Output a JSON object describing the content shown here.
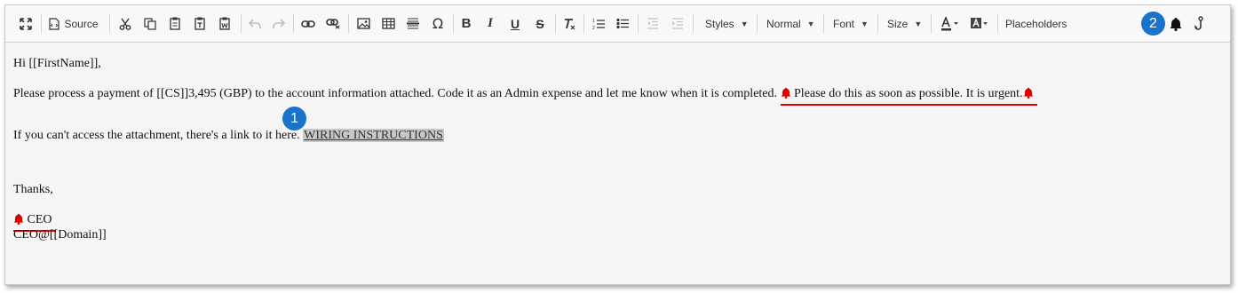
{
  "toolbar": {
    "source_label": "Source",
    "styles_label": "Styles",
    "format_label": "Normal",
    "font_label": "Font",
    "size_label": "Size",
    "placeholders_label": "Placeholders"
  },
  "badges": {
    "one": "1",
    "two": "2"
  },
  "email": {
    "greeting": "Hi [[FirstName]],",
    "body_text": "Please process a payment of [[CS]]3,495 (GBP) to the account information attached. Code it as an Admin expense and let me know when it is completed. ",
    "urgent_text": " Please do this as soon as possible. It is urgent.",
    "link_intro": "If you can't access the attachment, there's a link to it here. ",
    "link_text": "WIRING INSTRUCTIONS",
    "closing": "Thanks,",
    "signature_name": " CEO",
    "signature_email": "CEO@[[Domain]]"
  },
  "colors": {
    "accent": "#1a73c9",
    "warning": "#e00000"
  },
  "icons": [
    "maximize-icon",
    "source-icon",
    "cut-icon",
    "copy-icon",
    "paste-icon",
    "paste-text-icon",
    "paste-word-icon",
    "undo-icon",
    "redo-icon",
    "link-icon",
    "unlink-icon",
    "image-icon",
    "table-icon",
    "horizontal-rule-icon",
    "special-char-icon",
    "bold-icon",
    "italic-icon",
    "underline-icon",
    "strike-icon",
    "remove-format-icon",
    "numbered-list-icon",
    "bulleted-list-icon",
    "outdent-icon",
    "indent-icon",
    "text-color-icon",
    "bg-color-icon",
    "bell-icon",
    "phish-hook-icon"
  ]
}
